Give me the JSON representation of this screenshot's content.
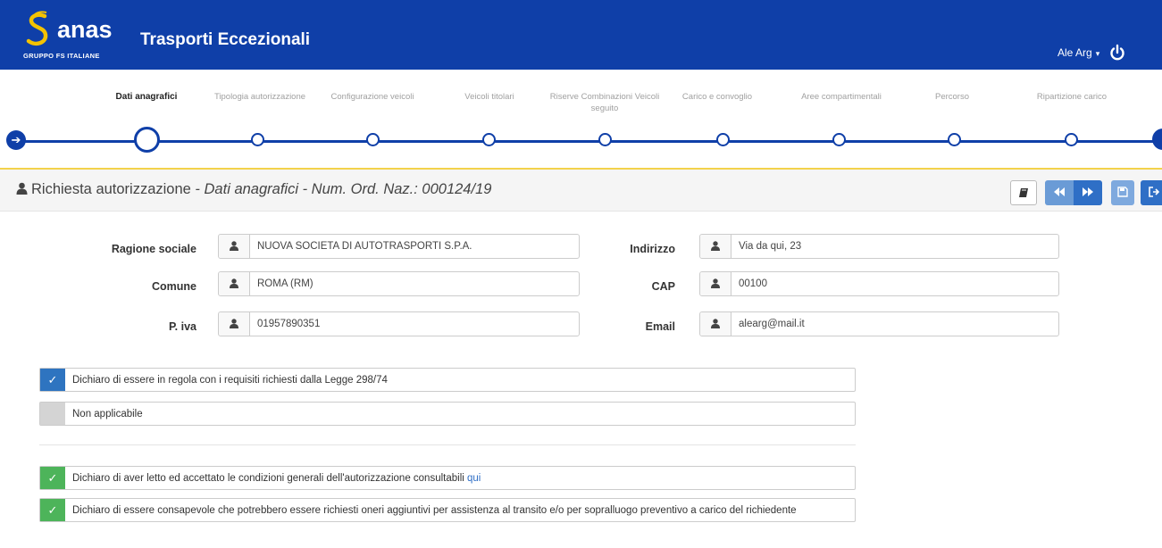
{
  "header": {
    "brand": "anas",
    "brand_sub": "GRUPPO FS ITALIANE",
    "title": "Trasporti Eccezionali",
    "user": "Ale Arg",
    "user_caret": "▾",
    "color": "#0f3fa8"
  },
  "wizard": {
    "steps": [
      {
        "label": "Dati anagrafici",
        "active": true
      },
      {
        "label": "Tipologia autorizzazione",
        "active": false
      },
      {
        "label": "Configurazione veicoli",
        "active": false
      },
      {
        "label": "Veicoli titolari",
        "active": false
      },
      {
        "label": "Riserve Combinazioni Veicoli seguito",
        "active": false
      },
      {
        "label": "Carico e convoglio",
        "active": false
      },
      {
        "label": "Aree compartimentali",
        "active": false
      },
      {
        "label": "Percorso",
        "active": false
      },
      {
        "label": "Ripartizione carico",
        "active": false
      }
    ],
    "accent": "#f3d24b"
  },
  "section": {
    "title_main": "Richiesta autorizzazione",
    "title_sep": " - ",
    "title_sub": "Dati anagrafici - Num. Ord. Naz.: 000124/19"
  },
  "form": {
    "ragione_sociale": {
      "label": "Ragione sociale",
      "value": "NUOVA SOCIETA DI AUTOTRASPORTI S.P.A."
    },
    "comune": {
      "label": "Comune",
      "value": "ROMA (RM)"
    },
    "piva": {
      "label": "P. iva",
      "value": "01957890351"
    },
    "indirizzo": {
      "label": "Indirizzo",
      "value": "Via da qui, 23"
    },
    "cap": {
      "label": "CAP",
      "value": "00100"
    },
    "email": {
      "label": "Email",
      "value": "alearg@mail.it"
    }
  },
  "declarations": {
    "requisiti": {
      "text": "Dichiaro di essere in regola con i requisiti richiesti dalla Legge 298/74",
      "checked": true
    },
    "non_applicabile": {
      "text": "Non applicabile",
      "checked": false
    },
    "condizioni": {
      "text": "Dichiaro di aver letto ed accettato le condizioni generali dell'autorizzazione consultabili",
      "link": "qui",
      "checked": true
    },
    "oneri": {
      "text": "Dichiaro di essere consapevole che potrebbero essere richiesti oneri aggiuntivi per assistenza al transito e/o per sopralluogo preventivo a carico del richiedente",
      "checked": true
    },
    "check_mark": "✓"
  }
}
